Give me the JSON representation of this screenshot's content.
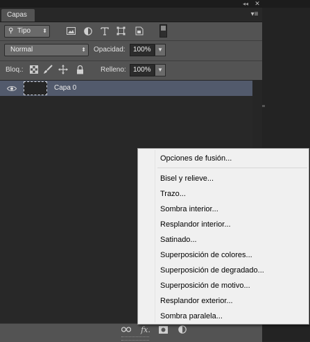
{
  "window": {
    "collapse_glyph": "◂◂",
    "close_glyph": "✕"
  },
  "panel": {
    "tab_label": "Capas",
    "menu_glyph": "▾≡"
  },
  "filter": {
    "type_label": "Tipo",
    "icons": [
      "image-filter-icon",
      "adjustment-filter-icon",
      "type-filter-icon",
      "shape-filter-icon",
      "smart-object-filter-icon",
      "filter-toggle-switch"
    ]
  },
  "blending": {
    "mode": "Normal",
    "opacity_label": "Opacidad:",
    "opacity_value": "100%"
  },
  "lock": {
    "label": "Bloq.:",
    "fill_label": "Relleno:",
    "fill_value": "100%",
    "icons": [
      "lock-transparent-pixels-icon",
      "lock-image-pixels-icon",
      "lock-position-icon",
      "lock-all-icon"
    ]
  },
  "layers": [
    {
      "name": "Capa 0",
      "visible": true,
      "selected": true
    }
  ],
  "bottom_bar": {
    "icons": [
      "link-layers-icon",
      "fx-icon",
      "add-mask-icon",
      "new-adjustment-icon",
      "new-group-icon",
      "new-layer-icon",
      "delete-layer-icon"
    ],
    "fx_label": "fx."
  },
  "context_menu": {
    "header_item": "Opciones de fusión...",
    "items": [
      "Bisel y relieve...",
      "Trazo...",
      "Sombra interior...",
      "Resplandor interior...",
      "Satinado...",
      "Superposición de colores...",
      "Superposición de degradado...",
      "Superposición de motivo...",
      "Resplandor exterior...",
      "Sombra paralela..."
    ]
  },
  "colors": {
    "panel_bg": "#535353",
    "list_bg": "#282828",
    "selected_row": "#525a6c",
    "menu_bg": "#f0f0f0"
  }
}
